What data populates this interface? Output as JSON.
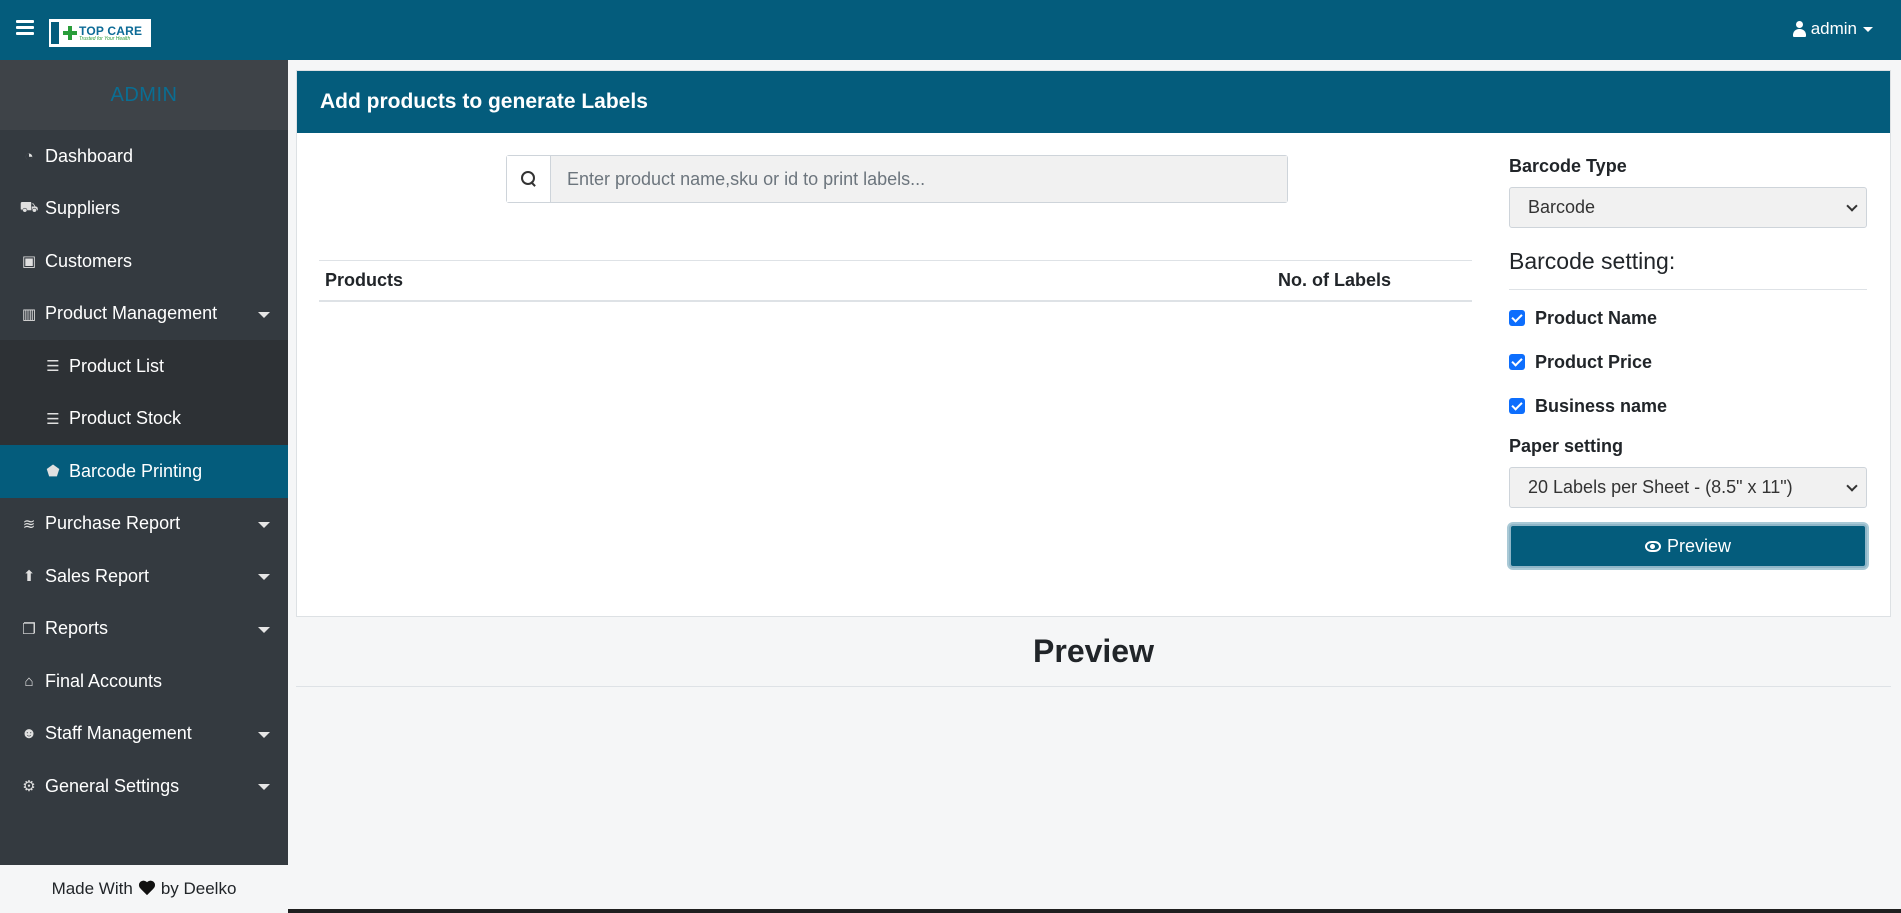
{
  "topbar": {
    "logo_title": "TOP CARE",
    "logo_tagline": "Trusted for Your Health",
    "user": "admin"
  },
  "sidebar": {
    "header": "ADMIN",
    "items": [
      {
        "label": "Dashboard",
        "icon": "dashboard-icon"
      },
      {
        "label": "Suppliers",
        "icon": "truck-icon"
      },
      {
        "label": "Customers",
        "icon": "id-badge-icon"
      },
      {
        "label": "Product Management",
        "icon": "barcode-icon"
      },
      {
        "label": "Product List",
        "icon": "list-icon"
      },
      {
        "label": "Product Stock",
        "icon": "list-icon"
      },
      {
        "label": "Barcode Printing",
        "icon": "tag-icon"
      },
      {
        "label": "Purchase Report",
        "icon": "database-icon"
      },
      {
        "label": "Sales Report",
        "icon": "upload-circle-icon"
      },
      {
        "label": "Reports",
        "icon": "copy-icon"
      },
      {
        "label": "Final Accounts",
        "icon": "bank-icon"
      },
      {
        "label": "Staff Management",
        "icon": "users-icon"
      },
      {
        "label": "General Settings",
        "icon": "cogs-icon"
      }
    ],
    "footer": {
      "made_with": "Made With",
      "by": "by Deelko"
    }
  },
  "main": {
    "card_title": "Add products to generate Labels",
    "search": {
      "placeholder": "Enter product name,sku or id to print labels...",
      "value": ""
    },
    "table": {
      "columns": [
        "Products",
        "No. of Labels"
      ],
      "rows": []
    },
    "settings": {
      "barcode_type_label": "Barcode Type",
      "barcode_type_value": "Barcode",
      "barcode_setting_title": "Barcode setting:",
      "checkboxes": [
        {
          "label": "Product Name",
          "checked": true
        },
        {
          "label": "Product Price",
          "checked": true
        },
        {
          "label": "Business name",
          "checked": true
        }
      ],
      "paper_setting_label": "Paper setting",
      "paper_setting_value": "20 Labels per Sheet - (8.5\" x 11\")",
      "preview_button": "Preview"
    },
    "preview_title": "Preview"
  },
  "colors": {
    "brand": "#045c7c",
    "sidebar_bg": "#343a40",
    "checkbox": "#0d6efd"
  }
}
